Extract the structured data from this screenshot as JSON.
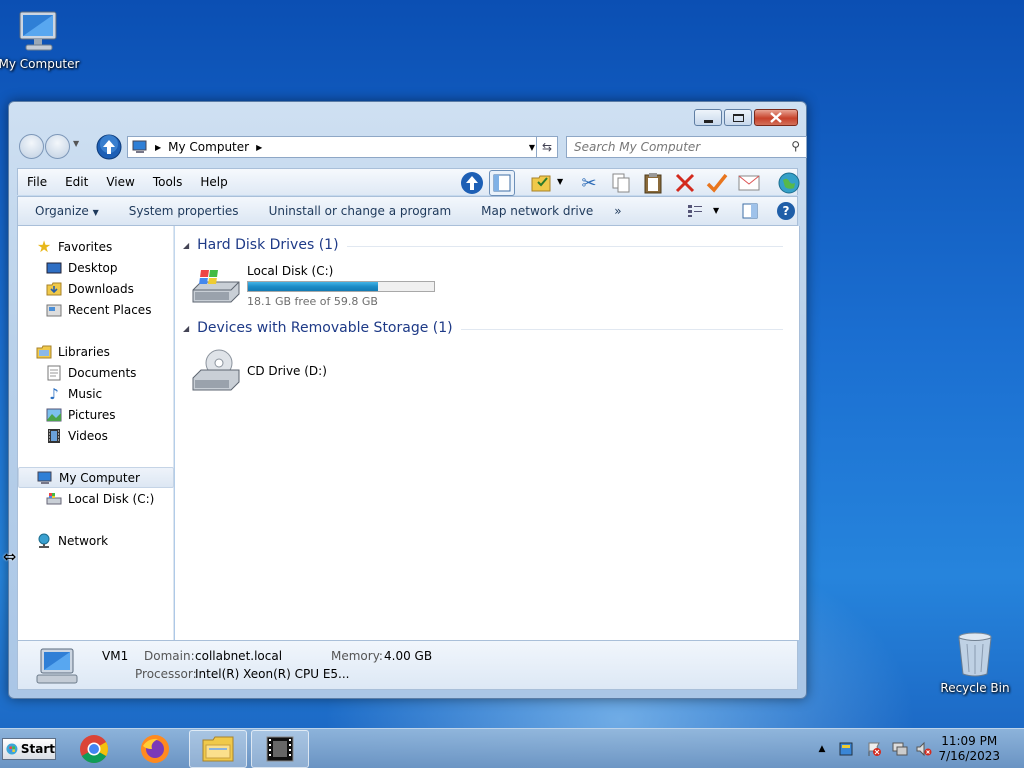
{
  "desktop": {
    "icons": [
      {
        "label": "My Computer",
        "icon": "computer-icon"
      },
      {
        "label": "Recycle Bin",
        "icon": "recycle-bin-icon"
      }
    ]
  },
  "window": {
    "address": {
      "segment": "My Computer",
      "icon": "computer-icon"
    },
    "search": {
      "placeholder": "Search My Computer"
    },
    "menu": [
      "File",
      "Edit",
      "View",
      "Tools",
      "Help"
    ],
    "toolbar_icons": [
      "up-arrow-icon",
      "panes-icon",
      "folder-options-icon",
      "cut-icon",
      "copy-icon",
      "paste-icon",
      "delete-icon",
      "properties-check-icon",
      "mail-icon",
      "globe-icon"
    ],
    "commands": {
      "organize": "Organize",
      "system_properties": "System properties",
      "uninstall": "Uninstall or change a program",
      "map_network": "Map network drive",
      "more": "»"
    },
    "nav": {
      "favorites": "Favorites",
      "desktop": "Desktop",
      "downloads": "Downloads",
      "recent": "Recent Places",
      "libraries": "Libraries",
      "documents": "Documents",
      "music": "Music",
      "pictures": "Pictures",
      "videos": "Videos",
      "my_computer": "My Computer",
      "local_disk": "Local Disk (C:)",
      "network": "Network"
    },
    "groups": {
      "hdd": "Hard Disk Drives (1)",
      "removable": "Devices with Removable Storage (1)"
    },
    "drives": {
      "c": {
        "name": "Local Disk (C:)",
        "free_text": "18.1 GB free of 59.8 GB",
        "used_fraction": 0.7
      },
      "d": {
        "name": "CD Drive (D:)"
      }
    },
    "details": {
      "name": "VM1",
      "domain_label": "Domain:",
      "domain": "collabnet.local",
      "memory_label": "Memory:",
      "memory": "4.00 GB",
      "processor_label": "Processor:",
      "processor": "Intel(R) Xeon(R) CPU E5..."
    }
  },
  "taskbar": {
    "start": "Start",
    "apps": [
      "chrome-icon",
      "firefox-icon",
      "explorer-icon",
      "media-icon"
    ],
    "clock": {
      "time": "11:09 PM",
      "date": "7/16/2023"
    }
  }
}
